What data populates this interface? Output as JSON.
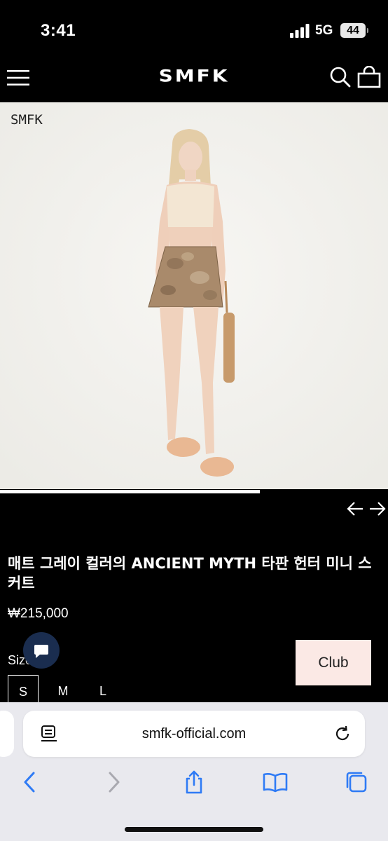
{
  "status_bar": {
    "time": "3:41",
    "network": "5G",
    "battery": "44"
  },
  "header": {
    "logo": "SMFK"
  },
  "product": {
    "image_watermark": "SMFK",
    "image_progress": 0.67,
    "title": "매트 그레이 컬러의 ANCIENT MYTH 타판 헌터 미니 스커트",
    "price": "₩215,000",
    "size_label": "Size",
    "sizes": [
      "S",
      "M",
      "L"
    ],
    "selected_size": "S"
  },
  "club_button": {
    "label": "Club"
  },
  "browser": {
    "url": "smfk-official.com"
  },
  "colors": {
    "background": "#000000",
    "accent": "#2f7bf5",
    "club_bg": "#fbe9e5",
    "chat_bg": "#1a2d4f"
  }
}
